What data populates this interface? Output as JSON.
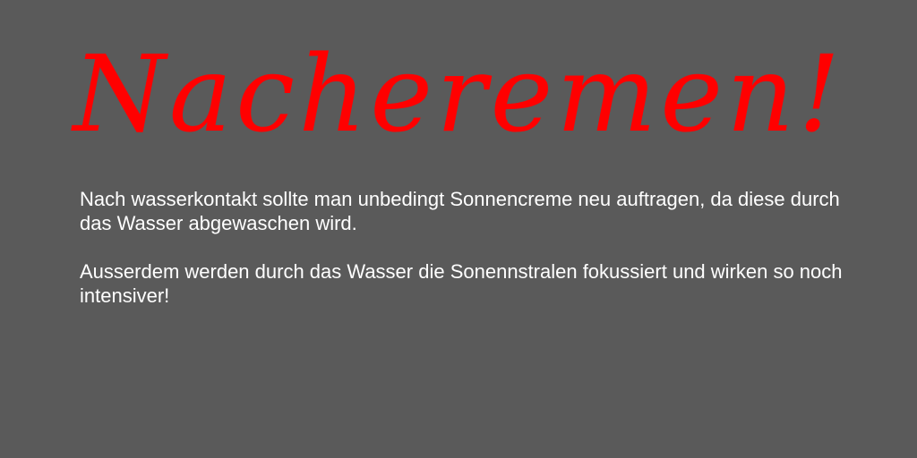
{
  "headline": "Nacheremen!",
  "paragraphs": [
    "Nach wasserkontakt sollte man unbedingt Sonnencreme neu auftragen, da diese durch das Wasser abgewaschen wird.",
    "Ausserdem werden durch das Wasser die Sonennstralen fokussiert und wirken so noch intensiver!"
  ],
  "colors": {
    "background": "#5a5a5a",
    "headline": "#ff0000",
    "text": "#ffffff"
  }
}
